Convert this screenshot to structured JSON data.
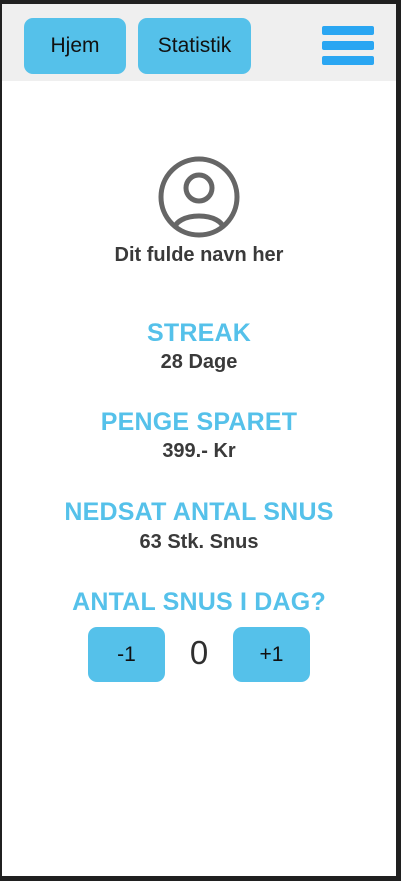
{
  "nav": {
    "home_label": "Hjem",
    "stats_label": "Statistik",
    "menu_icon": "hamburger-menu-icon"
  },
  "profile": {
    "avatar_icon": "user-circle-icon",
    "name": "Dit fulde navn her"
  },
  "stats": {
    "streak_label": "STREAK",
    "streak_value": "28 Dage",
    "money_label": "PENGE SPARET",
    "money_value": "399.- Kr",
    "reduced_label": "NEDSAT ANTAL SNUS",
    "reduced_value": "63 Stk. Snus"
  },
  "counter": {
    "question": "ANTAL SNUS I DAG?",
    "minus_label": "-1",
    "value": "0",
    "plus_label": "+1"
  },
  "colors": {
    "accent": "#55c1ea",
    "menu": "#2aa6f2",
    "text": "#3a3a3a",
    "topbar": "#efefef"
  }
}
